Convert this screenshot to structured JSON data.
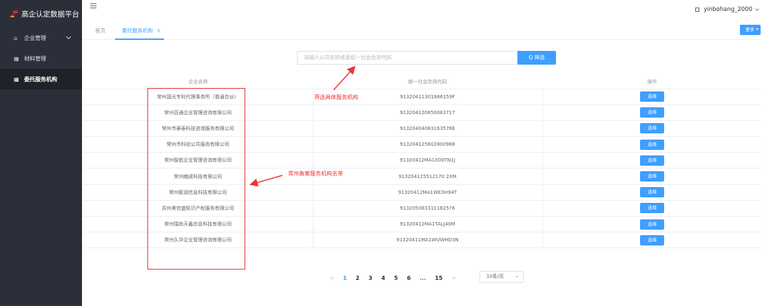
{
  "app": {
    "title": "高企认定数据平台"
  },
  "sidebar": {
    "items": [
      {
        "label": "企业管理",
        "icon": "home-icon"
      },
      {
        "label": "材料管理",
        "icon": "grid-icon"
      },
      {
        "label": "委托服务机构",
        "icon": "grid-icon"
      }
    ]
  },
  "header": {
    "username": "yinbohang_2000"
  },
  "tabs": {
    "home": "首页",
    "active": "委托服务机构",
    "close": "×",
    "more": "更多"
  },
  "search": {
    "placeholder": "请输入公司名称或者统一社会信用代码",
    "button": "Q 筛选"
  },
  "table": {
    "headers": [
      "企业名称",
      "统一社会信用代码",
      "操作"
    ],
    "action_label": "选择",
    "rows": [
      [
        "常州国光专利代理事务所（普通合伙）",
        "91320411301886159F"
      ],
      [
        "常州百通企业管理咨询有限公司",
        "913204120850063717"
      ],
      [
        "常州市豪泰科技咨询服务有限公司",
        "91320404083163576E"
      ],
      [
        "常州市科创公共服务有限公司",
        "913204125602800988"
      ],
      [
        "常州智航企业管理咨询有限公司",
        "91320412MA1X00TN1J"
      ],
      [
        "常州楠成科技有限公司",
        "913204125512170 2XM"
      ],
      [
        "常州联润信息科技有限公司",
        "91320412MA1WE3H94T"
      ],
      [
        "苏州美信盛知识产权服务有限公司",
        "913205083311182576"
      ],
      [
        "常州瑞尚天鑫信息科技有限公司",
        "91320412MA1TALJ40M"
      ],
      [
        "常州久华企业管理咨询有限公司",
        "91320411MA1WUWHD3N"
      ]
    ]
  },
  "annotations": {
    "filter": "筛选具体服务机构",
    "list": "常州备案服务机构名单"
  },
  "pagination": {
    "prev": "<",
    "next": ">",
    "pages": [
      "1",
      "2",
      "3",
      "4",
      "5",
      "6",
      "...",
      "15"
    ],
    "current": "1",
    "page_size": "10条/页"
  },
  "colors": {
    "accent": "#409eff",
    "sidebar_bg": "#2b2f3a",
    "annotation": "#ee3333"
  }
}
